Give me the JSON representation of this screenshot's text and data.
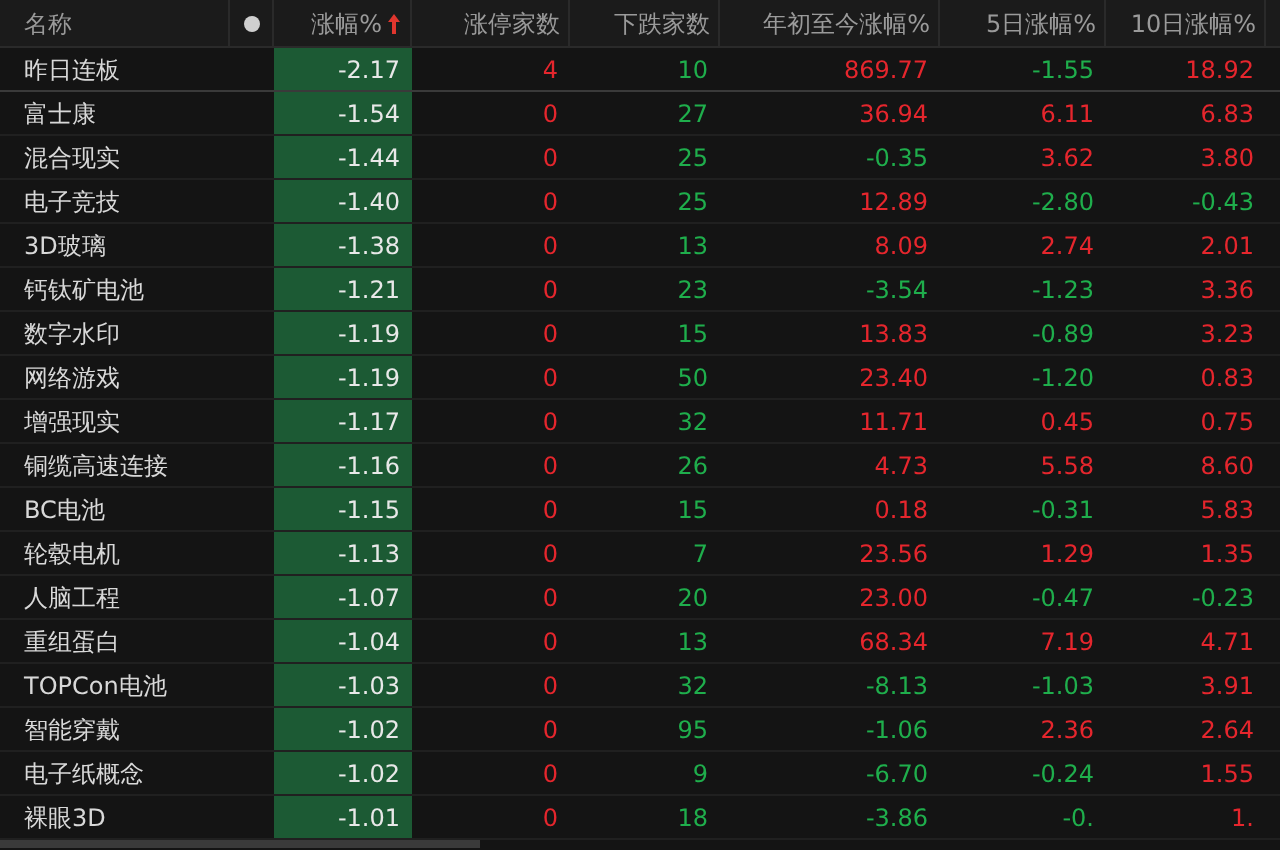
{
  "columns": [
    {
      "label": "名称",
      "sorted": false
    },
    {
      "label": "涨幅%",
      "sorted": true
    },
    {
      "label": "涨停家数",
      "sorted": false
    },
    {
      "label": "下跌家数",
      "sorted": false
    },
    {
      "label": "年初至今涨幅%",
      "sorted": false
    },
    {
      "label": "5日涨幅%",
      "sorted": false
    },
    {
      "label": "10日涨幅%",
      "sorted": false
    }
  ],
  "rows": [
    {
      "name": "昨日连板",
      "cells": [
        {
          "text": "-2.17",
          "rising": false
        },
        {
          "text": "4",
          "rising": true
        },
        {
          "text": "10",
          "rising": false
        },
        {
          "text": "869.77",
          "rising": true
        },
        {
          "text": "-1.55",
          "rising": false
        },
        {
          "text": "18.92",
          "rising": true
        }
      ]
    },
    {
      "name": "富士康",
      "cells": [
        {
          "text": "-1.54",
          "rising": false
        },
        {
          "text": "0",
          "rising": true
        },
        {
          "text": "27",
          "rising": false
        },
        {
          "text": "36.94",
          "rising": true
        },
        {
          "text": "6.11",
          "rising": true
        },
        {
          "text": "6.83",
          "rising": true
        }
      ]
    },
    {
      "name": "混合现实",
      "cells": [
        {
          "text": "-1.44",
          "rising": false
        },
        {
          "text": "0",
          "rising": true
        },
        {
          "text": "25",
          "rising": false
        },
        {
          "text": "-0.35",
          "rising": false
        },
        {
          "text": "3.62",
          "rising": true
        },
        {
          "text": "3.80",
          "rising": true
        }
      ]
    },
    {
      "name": "电子竞技",
      "cells": [
        {
          "text": "-1.40",
          "rising": false
        },
        {
          "text": "0",
          "rising": true
        },
        {
          "text": "25",
          "rising": false
        },
        {
          "text": "12.89",
          "rising": true
        },
        {
          "text": "-2.80",
          "rising": false
        },
        {
          "text": "-0.43",
          "rising": false
        }
      ]
    },
    {
      "name": "3D玻璃",
      "cells": [
        {
          "text": "-1.38",
          "rising": false
        },
        {
          "text": "0",
          "rising": true
        },
        {
          "text": "13",
          "rising": false
        },
        {
          "text": "8.09",
          "rising": true
        },
        {
          "text": "2.74",
          "rising": true
        },
        {
          "text": "2.01",
          "rising": true
        }
      ]
    },
    {
      "name": "钙钛矿电池",
      "cells": [
        {
          "text": "-1.21",
          "rising": false
        },
        {
          "text": "0",
          "rising": true
        },
        {
          "text": "23",
          "rising": false
        },
        {
          "text": "-3.54",
          "rising": false
        },
        {
          "text": "-1.23",
          "rising": false
        },
        {
          "text": "3.36",
          "rising": true
        }
      ]
    },
    {
      "name": "数字水印",
      "cells": [
        {
          "text": "-1.19",
          "rising": false
        },
        {
          "text": "0",
          "rising": true
        },
        {
          "text": "15",
          "rising": false
        },
        {
          "text": "13.83",
          "rising": true
        },
        {
          "text": "-0.89",
          "rising": false
        },
        {
          "text": "3.23",
          "rising": true
        }
      ]
    },
    {
      "name": "网络游戏",
      "cells": [
        {
          "text": "-1.19",
          "rising": false
        },
        {
          "text": "0",
          "rising": true
        },
        {
          "text": "50",
          "rising": false
        },
        {
          "text": "23.40",
          "rising": true
        },
        {
          "text": "-1.20",
          "rising": false
        },
        {
          "text": "0.83",
          "rising": true
        }
      ]
    },
    {
      "name": "增强现实",
      "cells": [
        {
          "text": "-1.17",
          "rising": false
        },
        {
          "text": "0",
          "rising": true
        },
        {
          "text": "32",
          "rising": false
        },
        {
          "text": "11.71",
          "rising": true
        },
        {
          "text": "0.45",
          "rising": true
        },
        {
          "text": "0.75",
          "rising": true
        }
      ]
    },
    {
      "name": "铜缆高速连接",
      "cells": [
        {
          "text": "-1.16",
          "rising": false
        },
        {
          "text": "0",
          "rising": true
        },
        {
          "text": "26",
          "rising": false
        },
        {
          "text": "4.73",
          "rising": true
        },
        {
          "text": "5.58",
          "rising": true
        },
        {
          "text": "8.60",
          "rising": true
        }
      ]
    },
    {
      "name": "BC电池",
      "cells": [
        {
          "text": "-1.15",
          "rising": false
        },
        {
          "text": "0",
          "rising": true
        },
        {
          "text": "15",
          "rising": false
        },
        {
          "text": "0.18",
          "rising": true
        },
        {
          "text": "-0.31",
          "rising": false
        },
        {
          "text": "5.83",
          "rising": true
        }
      ]
    },
    {
      "name": "轮毂电机",
      "cells": [
        {
          "text": "-1.13",
          "rising": false
        },
        {
          "text": "0",
          "rising": true
        },
        {
          "text": "7",
          "rising": false
        },
        {
          "text": "23.56",
          "rising": true
        },
        {
          "text": "1.29",
          "rising": true
        },
        {
          "text": "1.35",
          "rising": true
        }
      ]
    },
    {
      "name": "人脑工程",
      "cells": [
        {
          "text": "-1.07",
          "rising": false
        },
        {
          "text": "0",
          "rising": true
        },
        {
          "text": "20",
          "rising": false
        },
        {
          "text": "23.00",
          "rising": true
        },
        {
          "text": "-0.47",
          "rising": false
        },
        {
          "text": "-0.23",
          "rising": false
        }
      ]
    },
    {
      "name": "重组蛋白",
      "cells": [
        {
          "text": "-1.04",
          "rising": false
        },
        {
          "text": "0",
          "rising": true
        },
        {
          "text": "13",
          "rising": false
        },
        {
          "text": "68.34",
          "rising": true
        },
        {
          "text": "7.19",
          "rising": true
        },
        {
          "text": "4.71",
          "rising": true
        }
      ]
    },
    {
      "name": "TOPCon电池",
      "cells": [
        {
          "text": "-1.03",
          "rising": false
        },
        {
          "text": "0",
          "rising": true
        },
        {
          "text": "32",
          "rising": false
        },
        {
          "text": "-8.13",
          "rising": false
        },
        {
          "text": "-1.03",
          "rising": false
        },
        {
          "text": "3.91",
          "rising": true
        }
      ]
    },
    {
      "name": "智能穿戴",
      "cells": [
        {
          "text": "-1.02",
          "rising": false
        },
        {
          "text": "0",
          "rising": true
        },
        {
          "text": "95",
          "rising": false
        },
        {
          "text": "-1.06",
          "rising": false
        },
        {
          "text": "2.36",
          "rising": true
        },
        {
          "text": "2.64",
          "rising": true
        }
      ]
    },
    {
      "name": "电子纸概念",
      "cells": [
        {
          "text": "-1.02",
          "rising": false
        },
        {
          "text": "0",
          "rising": true
        },
        {
          "text": "9",
          "rising": false
        },
        {
          "text": "-6.70",
          "rising": false
        },
        {
          "text": "-0.24",
          "rising": false
        },
        {
          "text": "1.55",
          "rising": true
        }
      ]
    },
    {
      "name": "裸眼3D",
      "cells": [
        {
          "text": "-1.01",
          "rising": false
        },
        {
          "text": "0",
          "rising": true
        },
        {
          "text": "18",
          "rising": false
        },
        {
          "text": "-3.86",
          "rising": false
        },
        {
          "text": "-0.",
          "rising": false
        },
        {
          "text": "1.",
          "rising": true
        }
      ]
    }
  ]
}
